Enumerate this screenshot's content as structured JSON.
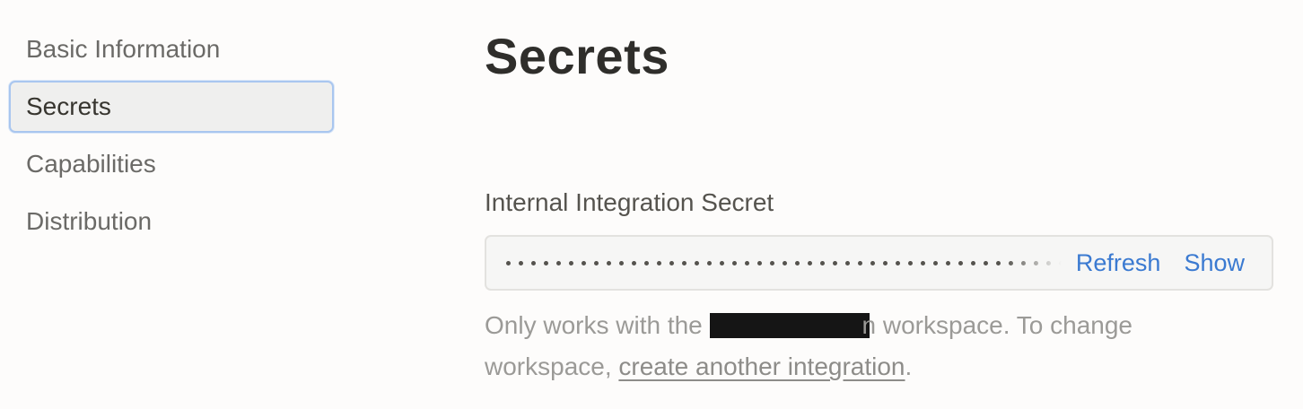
{
  "sidebar": {
    "items": [
      {
        "label": "Basic Information"
      },
      {
        "label": "Secrets"
      },
      {
        "label": "Capabilities"
      },
      {
        "label": "Distribution"
      }
    ]
  },
  "main": {
    "title": "Secrets",
    "secret_section": {
      "label": "Internal Integration Secret",
      "refresh_label": "Refresh",
      "show_label": "Show"
    },
    "help": {
      "prefix": "Only works with the ",
      "redacted_tail": "n",
      "middle": " workspace. To change workspace, ",
      "link_text": "create another integration",
      "suffix": "."
    }
  },
  "colors": {
    "accent_link": "#3b7ad1",
    "active_border": "#a9c6ef"
  }
}
